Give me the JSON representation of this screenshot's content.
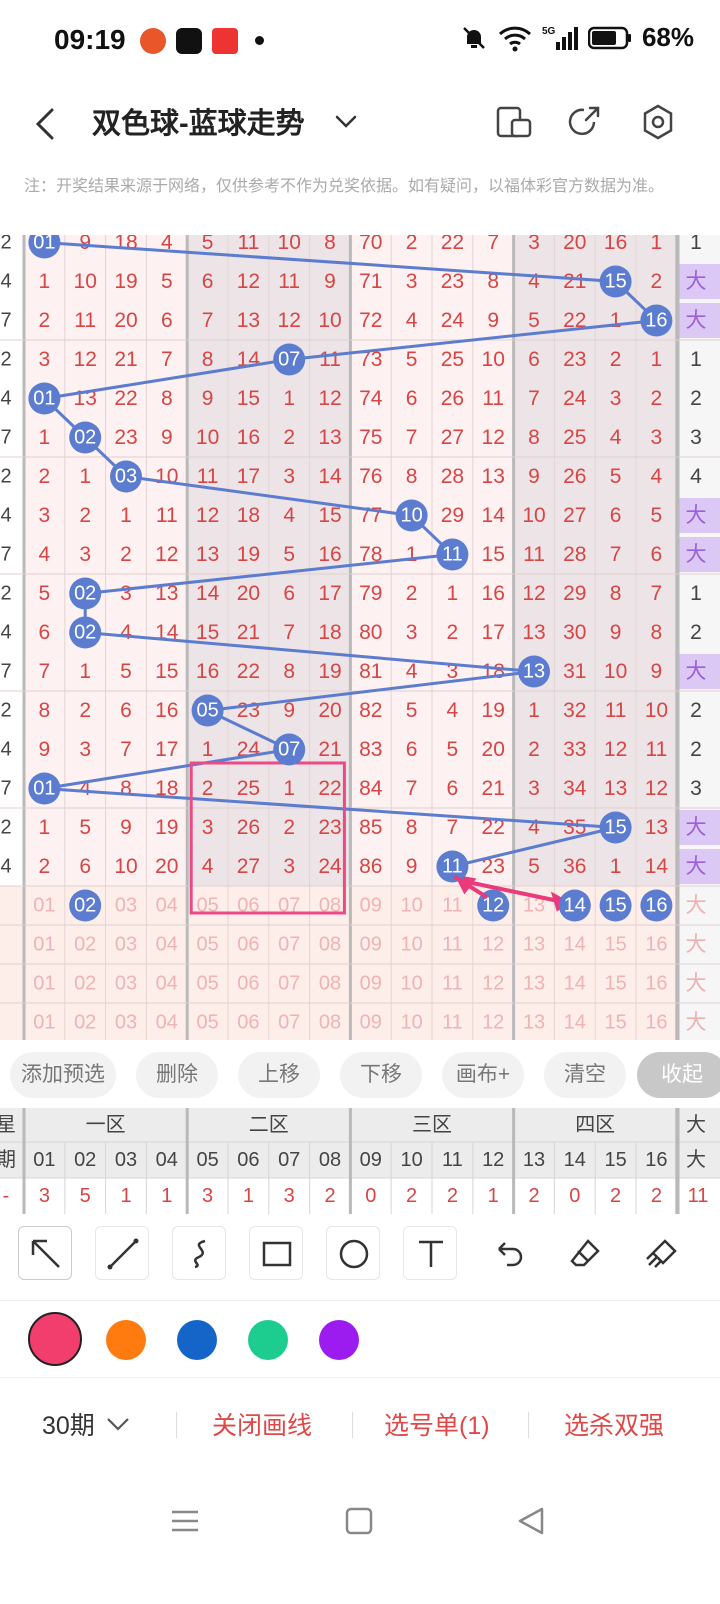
{
  "status": {
    "time": "09:19",
    "battery": "68%",
    "network": "5G"
  },
  "header": {
    "title": "双色球-蓝球走势"
  },
  "note": "注：开奖结果来源于网络，仅供参考不作为兑奖依据。如有疑问，以福体彩官方数据为准。",
  "grid": {
    "left_col": [
      "2",
      "4",
      "7",
      "2",
      "4",
      "7",
      "2",
      "4",
      "7",
      "2",
      "4",
      "7",
      "2",
      "4",
      "7",
      "2",
      "4",
      "",
      "",
      "",
      ""
    ],
    "rows": [
      [
        "01",
        "9",
        "18",
        "4",
        "5",
        "11",
        "10",
        "8",
        "70",
        "2",
        "22",
        "7",
        "3",
        "20",
        "16",
        "1"
      ],
      [
        "1",
        "10",
        "19",
        "5",
        "6",
        "12",
        "11",
        "9",
        "71",
        "3",
        "23",
        "8",
        "4",
        "21",
        "15",
        "2"
      ],
      [
        "2",
        "11",
        "20",
        "6",
        "7",
        "13",
        "12",
        "10",
        "72",
        "4",
        "24",
        "9",
        "5",
        "22",
        "1",
        "16"
      ],
      [
        "3",
        "12",
        "21",
        "7",
        "8",
        "14",
        "07",
        "11",
        "73",
        "5",
        "25",
        "10",
        "6",
        "23",
        "2",
        "1"
      ],
      [
        "01",
        "13",
        "22",
        "8",
        "9",
        "15",
        "1",
        "12",
        "74",
        "6",
        "26",
        "11",
        "7",
        "24",
        "3",
        "2"
      ],
      [
        "1",
        "02",
        "23",
        "9",
        "10",
        "16",
        "2",
        "13",
        "75",
        "7",
        "27",
        "12",
        "8",
        "25",
        "4",
        "3"
      ],
      [
        "2",
        "1",
        "03",
        "10",
        "11",
        "17",
        "3",
        "14",
        "76",
        "8",
        "28",
        "13",
        "9",
        "26",
        "5",
        "4"
      ],
      [
        "3",
        "2",
        "1",
        "11",
        "12",
        "18",
        "4",
        "15",
        "77",
        "10",
        "29",
        "14",
        "10",
        "27",
        "6",
        "5"
      ],
      [
        "4",
        "3",
        "2",
        "12",
        "13",
        "19",
        "5",
        "16",
        "78",
        "1",
        "11",
        "15",
        "11",
        "28",
        "7",
        "6"
      ],
      [
        "5",
        "02",
        "3",
        "13",
        "14",
        "20",
        "6",
        "17",
        "79",
        "2",
        "1",
        "16",
        "12",
        "29",
        "8",
        "7"
      ],
      [
        "6",
        "02",
        "4",
        "14",
        "15",
        "21",
        "7",
        "18",
        "80",
        "3",
        "2",
        "17",
        "13",
        "30",
        "9",
        "8"
      ],
      [
        "7",
        "1",
        "5",
        "15",
        "16",
        "22",
        "8",
        "19",
        "81",
        "4",
        "3",
        "18",
        "13",
        "31",
        "10",
        "9"
      ],
      [
        "8",
        "2",
        "6",
        "16",
        "05",
        "23",
        "9",
        "20",
        "82",
        "5",
        "4",
        "19",
        "1",
        "32",
        "11",
        "10"
      ],
      [
        "9",
        "3",
        "7",
        "17",
        "1",
        "24",
        "07",
        "21",
        "83",
        "6",
        "5",
        "20",
        "2",
        "33",
        "12",
        "11"
      ],
      [
        "01",
        "4",
        "8",
        "18",
        "2",
        "25",
        "1",
        "22",
        "84",
        "7",
        "6",
        "21",
        "3",
        "34",
        "13",
        "12"
      ],
      [
        "1",
        "5",
        "9",
        "19",
        "3",
        "26",
        "2",
        "23",
        "85",
        "8",
        "7",
        "22",
        "4",
        "35",
        "15",
        "13"
      ],
      [
        "2",
        "6",
        "10",
        "20",
        "4",
        "27",
        "3",
        "24",
        "86",
        "9",
        "11",
        "23",
        "5",
        "36",
        "1",
        "14"
      ],
      [
        "01",
        "02",
        "03",
        "04",
        "05",
        "06",
        "07",
        "08",
        "09",
        "10",
        "11",
        "12",
        "13",
        "14",
        "15",
        "16"
      ],
      [
        "01",
        "02",
        "03",
        "04",
        "05",
        "06",
        "07",
        "08",
        "09",
        "10",
        "11",
        "12",
        "13",
        "14",
        "15",
        "16"
      ],
      [
        "01",
        "02",
        "03",
        "04",
        "05",
        "06",
        "07",
        "08",
        "09",
        "10",
        "11",
        "12",
        "13",
        "14",
        "15",
        "16"
      ],
      [
        "01",
        "02",
        "03",
        "04",
        "05",
        "06",
        "07",
        "08",
        "09",
        "10",
        "11",
        "12",
        "13",
        "14",
        "15",
        "16"
      ]
    ],
    "right_col": [
      "1",
      "大",
      "大",
      "1",
      "2",
      "3",
      "4",
      "大",
      "大",
      "1",
      "2",
      "大",
      "2",
      "2",
      "3",
      "大",
      "大",
      "大",
      "大",
      "大",
      "大"
    ],
    "balls": [
      {
        "r": 0,
        "c": 0,
        "label": "01"
      },
      {
        "r": 1,
        "c": 14,
        "label": "15"
      },
      {
        "r": 2,
        "c": 15,
        "label": "16"
      },
      {
        "r": 3,
        "c": 6,
        "label": "07"
      },
      {
        "r": 4,
        "c": 0,
        "label": "01"
      },
      {
        "r": 5,
        "c": 1,
        "label": "02"
      },
      {
        "r": 6,
        "c": 2,
        "label": "03"
      },
      {
        "r": 7,
        "c": 9,
        "label": "10"
      },
      {
        "r": 8,
        "c": 10,
        "label": "11"
      },
      {
        "r": 9,
        "c": 1,
        "label": "02"
      },
      {
        "r": 10,
        "c": 1,
        "label": "02"
      },
      {
        "r": 11,
        "c": 12,
        "label": "13"
      },
      {
        "r": 12,
        "c": 4,
        "label": "05"
      },
      {
        "r": 13,
        "c": 6,
        "label": "07"
      },
      {
        "r": 14,
        "c": 0,
        "label": "01"
      },
      {
        "r": 15,
        "c": 14,
        "label": "15"
      },
      {
        "r": 16,
        "c": 10,
        "label": "11"
      }
    ],
    "selected": [
      {
        "r": 17,
        "c": 1,
        "label": "02"
      },
      {
        "r": 17,
        "c": 11,
        "label": "12"
      },
      {
        "r": 17,
        "c": 13,
        "label": "14"
      },
      {
        "r": 17,
        "c": 14,
        "label": "15"
      },
      {
        "r": 17,
        "c": 15,
        "label": "16"
      }
    ]
  },
  "presel_buttons": [
    "添加预选",
    "删除",
    "上移",
    "下移",
    "画布+",
    "清空",
    "收起"
  ],
  "summary": {
    "col0": [
      "星",
      "期",
      "-"
    ],
    "zones": [
      "一区",
      "二区",
      "三区",
      "四区"
    ],
    "zone_tail": "大",
    "numbers": [
      "01",
      "02",
      "03",
      "04",
      "05",
      "06",
      "07",
      "08",
      "09",
      "10",
      "11",
      "12",
      "13",
      "14",
      "15",
      "16"
    ],
    "num_tail": "大",
    "counts": [
      "3",
      "5",
      "1",
      "1",
      "3",
      "1",
      "3",
      "2",
      "0",
      "2",
      "2",
      "1",
      "2",
      "0",
      "2",
      "2"
    ],
    "count_tail": "11"
  },
  "tools": [
    "arrow-tool",
    "line-tool",
    "curve-tool",
    "rect-tool",
    "circle-tool",
    "text-tool",
    "undo-tool",
    "eraser-tool",
    "clear-tool"
  ],
  "colors": [
    "#F23E6C",
    "#FF7A0F",
    "#1565C8",
    "#1DCC8F",
    "#9C1CF0"
  ],
  "bottom": {
    "period": "30期",
    "close_lines": "关闭画线",
    "selection": "选号单(1)",
    "kill": "选杀双强"
  }
}
